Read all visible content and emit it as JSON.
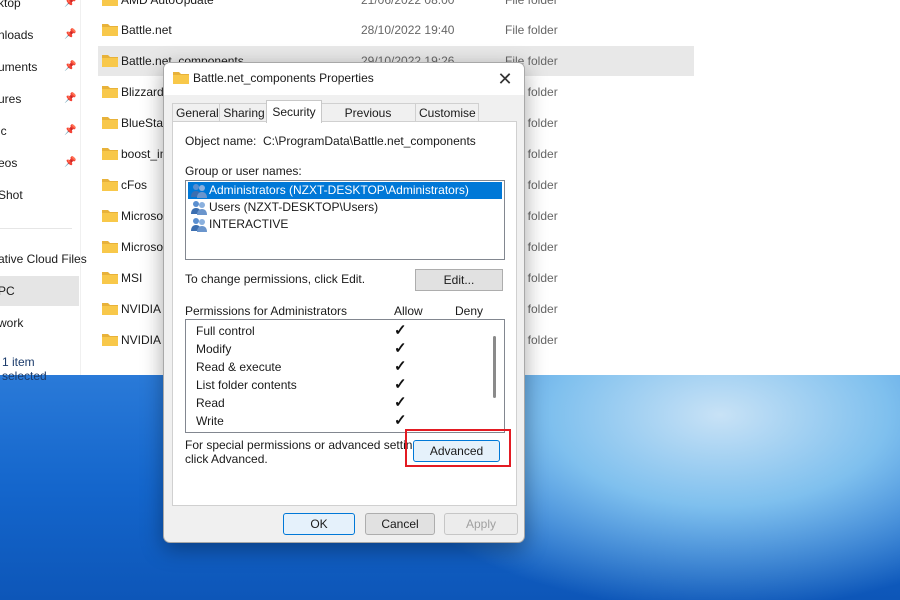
{
  "explorer": {
    "nav_items": [
      {
        "label": "ktop",
        "pinned": true
      },
      {
        "label": "nloads",
        "pinned": true
      },
      {
        "label": "uments",
        "pinned": true
      },
      {
        "label": "ures",
        "pinned": true
      },
      {
        "label": "ic",
        "pinned": true
      },
      {
        "label": "eos",
        "pinned": true
      },
      {
        "label": "Shot",
        "pinned": false
      },
      {
        "label": "ative Cloud Files",
        "pinned": false
      },
      {
        "label": "PC",
        "pinned": false
      },
      {
        "label": "work",
        "pinned": false
      }
    ],
    "status_text": "1 item selected",
    "files": [
      {
        "name": "AMD AutoUpdate",
        "date": "21/06/2022 08:00",
        "type": "File folder"
      },
      {
        "name": "Battle.net",
        "date": "28/10/2022 19:40",
        "type": "File folder"
      },
      {
        "name": "Battle.net_components",
        "date": "29/10/2022 19:26",
        "type": "File folder"
      },
      {
        "name": "Blizzard",
        "date": "",
        "type": "File folder"
      },
      {
        "name": "BlueStac",
        "date": "",
        "type": "File folder"
      },
      {
        "name": "boost_in",
        "date": "",
        "type": "File folder"
      },
      {
        "name": "cFos",
        "date": "",
        "type": "File folder"
      },
      {
        "name": "Microso",
        "date": "",
        "type": "File folder"
      },
      {
        "name": "Microso",
        "date": "",
        "type": "File folder"
      },
      {
        "name": "MSI",
        "date": "",
        "type": "File folder"
      },
      {
        "name": "NVIDIA",
        "date": "",
        "type": "File folder"
      },
      {
        "name": "NVIDIA",
        "date": "",
        "type": "File folder"
      }
    ]
  },
  "dialog": {
    "title": "Battle.net_components Properties",
    "close_glyph": "✕",
    "tabs": [
      "General",
      "Sharing",
      "Security",
      "Previous Versions",
      "Customise"
    ],
    "active_tab": "Security",
    "object_name_label": "Object name:",
    "object_name_value": "C:\\ProgramData\\Battle.net_components",
    "group_label": "Group or user names:",
    "users": [
      "Administrators (NZXT-DESKTOP\\Administrators)",
      "Users (NZXT-DESKTOP\\Users)",
      "INTERACTIVE"
    ],
    "change_text": "To change permissions, click Edit.",
    "edit_button": "Edit...",
    "permissions_label": "Permissions for Administrators",
    "allow_header": "Allow",
    "deny_header": "Deny",
    "permissions": [
      {
        "name": "Full control",
        "allow": true,
        "deny": false
      },
      {
        "name": "Modify",
        "allow": true,
        "deny": false
      },
      {
        "name": "Read & execute",
        "allow": true,
        "deny": false
      },
      {
        "name": "List folder contents",
        "allow": true,
        "deny": false
      },
      {
        "name": "Read",
        "allow": true,
        "deny": false
      },
      {
        "name": "Write",
        "allow": true,
        "deny": false
      }
    ],
    "check_glyph": "✓",
    "special_text_1": "For special permissions or advanced settings,",
    "special_text_2": "click Advanced.",
    "advanced_button": "Advanced",
    "ok_button": "OK",
    "cancel_button": "Cancel",
    "apply_button": "Apply"
  },
  "colors": {
    "selection": "#0078d7",
    "highlight": "#e31b23",
    "folder": "#f8c84a"
  }
}
